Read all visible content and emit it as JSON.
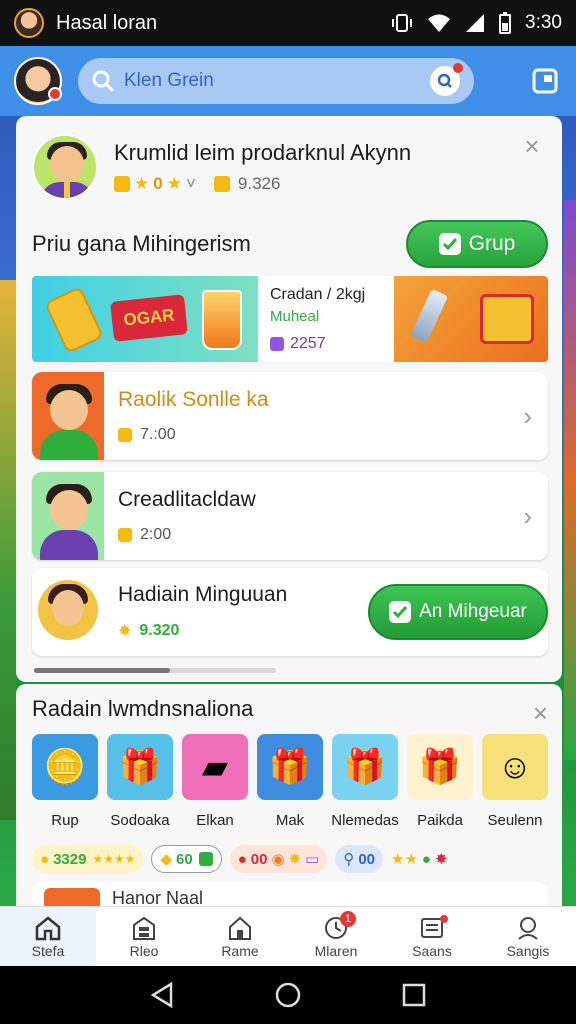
{
  "status_bar": {
    "title": "Hasal loran",
    "time": "3:30"
  },
  "header": {
    "search_placeholder": "Klen Grein"
  },
  "profile": {
    "name": "Krumlid leim prodarknul Akynn",
    "gold_count": "0",
    "coins": "9.326"
  },
  "section": {
    "title": "Priu gana Mihingerism",
    "grup_label": "Grup"
  },
  "banner": {
    "line1": "Cradan / 2kgj",
    "line2": "Muheal",
    "line3": "2257",
    "sign_text": "OGAR"
  },
  "rows": [
    {
      "title": "Raolik Sonlle ka",
      "amount": "7.:00"
    },
    {
      "title": "Creadlitacldaw",
      "amount": "2:00"
    },
    {
      "title": "Hadiain Minguuan",
      "amount": "9.320",
      "button_label": "An Mihgeuar"
    }
  ],
  "rewards": {
    "title": "Radain lwmdnsnaliona",
    "tiles": [
      {
        "label": "Rup",
        "icon": "smiley-coin-icon",
        "bg": "#3a9be0"
      },
      {
        "label": "Sodoaka",
        "icon": "gift-box-icon",
        "bg": "#56c0e8"
      },
      {
        "label": "Elkan",
        "icon": "gold-bar-icon",
        "bg": "#ef6fb8"
      },
      {
        "label": "Mak",
        "icon": "gift-box-icon",
        "bg": "#3f8de0"
      },
      {
        "label": "Nlemedas",
        "icon": "red-gift-icon",
        "bg": "#7ad3f0"
      },
      {
        "label": "Paikda",
        "icon": "gold-gift-icon",
        "bg": "#fff3cf"
      },
      {
        "label": "Seulenn",
        "icon": "avatar-icon",
        "bg": "#f7e07a"
      }
    ],
    "chips": [
      "3329",
      "★★★★",
      "60",
      "00",
      "00"
    ]
  },
  "peek_row": {
    "title": "Hanor Naal"
  },
  "nav": [
    {
      "label": "Stefa",
      "icon": "home-icon"
    },
    {
      "label": "Rleo",
      "icon": "shop-icon"
    },
    {
      "label": "Rame",
      "icon": "house-icon"
    },
    {
      "label": "Mlaren",
      "icon": "clock-icon",
      "badge": "1"
    },
    {
      "label": "Saans",
      "icon": "list-icon"
    },
    {
      "label": "Sangis",
      "icon": "profile-icon"
    }
  ],
  "colors": {
    "accent_blue": "#3f8ee8",
    "green": "#2fae3e",
    "gold": "#f5b90f"
  }
}
